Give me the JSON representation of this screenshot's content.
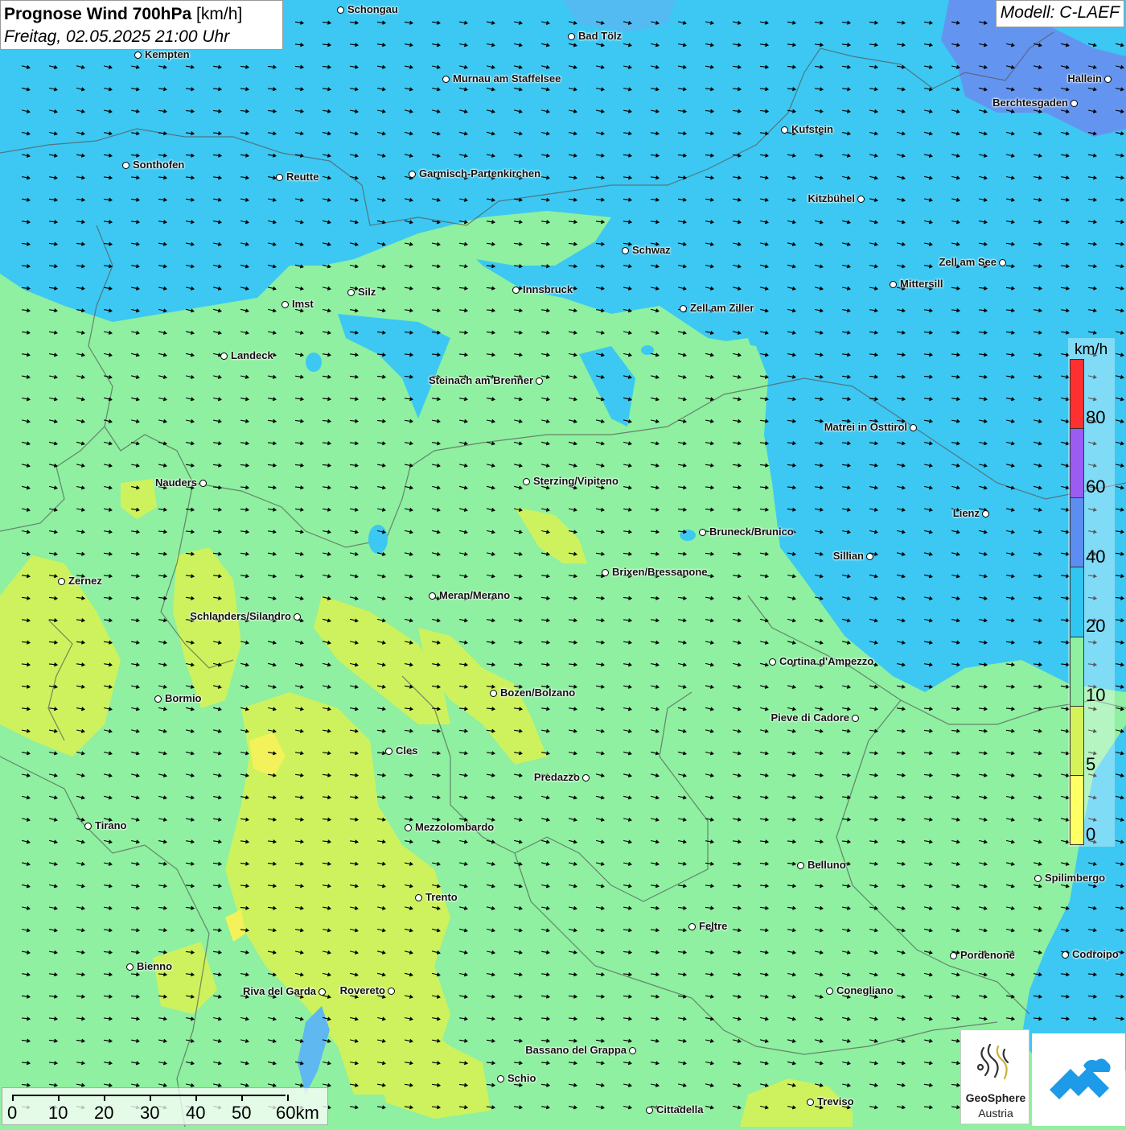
{
  "title": {
    "main": "Prognose Wind 700hPa",
    "unit": "[km/h]",
    "datetime": "Freitag, 02.05.2025 21:00 Uhr"
  },
  "model": "Modell: C-LAEF",
  "legend": {
    "unit": "km/h",
    "labels": [
      "80",
      "60",
      "40",
      "20",
      "10",
      "5",
      "0"
    ],
    "colors": [
      "#ff3030",
      "#9a5cf2",
      "#5c8ef2",
      "#30c6f0",
      "#8ef0a0",
      "#d6f25a",
      "#ffff66"
    ]
  },
  "cities": [
    {
      "name": "Schongau"
    },
    {
      "name": "Bad Tölz"
    },
    {
      "name": "Kempten"
    },
    {
      "name": "Murnau am Staffelsee"
    },
    {
      "name": "Hallein"
    },
    {
      "name": "Berchtesgaden"
    },
    {
      "name": "Kufstein"
    },
    {
      "name": "Sonthofen"
    },
    {
      "name": "Reutte"
    },
    {
      "name": "Garmisch-Partenkirchen"
    },
    {
      "name": "Kitzbühel"
    },
    {
      "name": "Schwaz"
    },
    {
      "name": "Zell am See"
    },
    {
      "name": "Mittersill"
    },
    {
      "name": "Silz"
    },
    {
      "name": "Innsbruck"
    },
    {
      "name": "Imst"
    },
    {
      "name": "Zell am Ziller"
    },
    {
      "name": "Landeck"
    },
    {
      "name": "Steinach am Brenner"
    },
    {
      "name": "Matrei in Osttirol"
    },
    {
      "name": "Nauders"
    },
    {
      "name": "Sterzing/Vipiteno"
    },
    {
      "name": "Lienz"
    },
    {
      "name": "Bruneck/Brunico"
    },
    {
      "name": "Sillian"
    },
    {
      "name": "Brixen/Bressanone"
    },
    {
      "name": "Zernez"
    },
    {
      "name": "Meran/Merano"
    },
    {
      "name": "Schlanders/Silandro"
    },
    {
      "name": "Cortina d'Ampezzo"
    },
    {
      "name": "Bozen/Bolzano"
    },
    {
      "name": "Bormio"
    },
    {
      "name": "Pieve di Cadore"
    },
    {
      "name": "Cles"
    },
    {
      "name": "Predazzo"
    },
    {
      "name": "Tirano"
    },
    {
      "name": "Mezzolombardo"
    },
    {
      "name": "Belluno"
    },
    {
      "name": "Spilimbergo"
    },
    {
      "name": "Trento"
    },
    {
      "name": "Feltre"
    },
    {
      "name": "Pordenone"
    },
    {
      "name": "Codroipo"
    },
    {
      "name": "Bienno"
    },
    {
      "name": "Riva del Garda"
    },
    {
      "name": "Rovereto"
    },
    {
      "name": "Conegliano"
    },
    {
      "name": "Bassano del Grappa"
    },
    {
      "name": "Schio"
    },
    {
      "name": "Treviso"
    },
    {
      "name": "Cittadella"
    }
  ],
  "scale": {
    "labels": [
      "0",
      "10",
      "20",
      "30",
      "40",
      "50",
      "60km"
    ]
  },
  "logos": {
    "geosphere_line1": "GeoSphere",
    "geosphere_line2": "Austria"
  },
  "wind_direction": "west-north-west to east-south-east"
}
